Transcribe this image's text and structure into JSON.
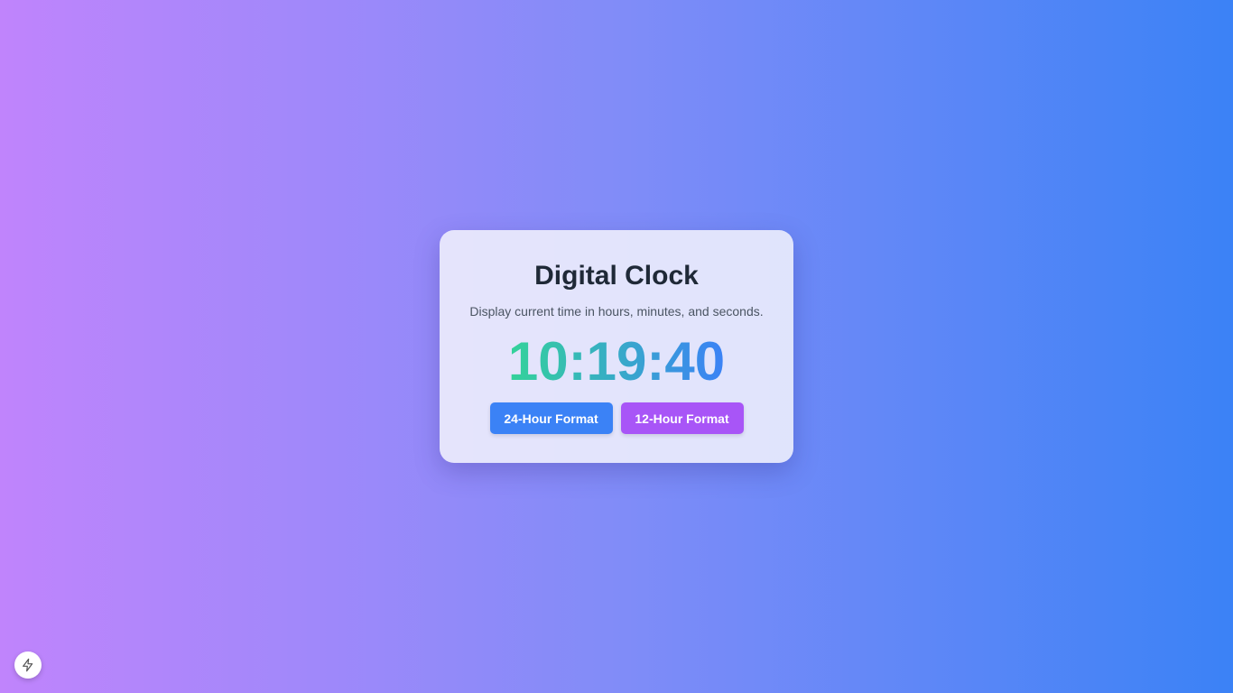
{
  "clock": {
    "title": "Digital Clock",
    "subtitle": "Display current time in hours, minutes, and seconds.",
    "time": "10:19:40",
    "buttons": {
      "format_24": "24-Hour Format",
      "format_12": "12-Hour Format"
    }
  },
  "corner_badge": {
    "icon": "lightning-bolt-icon"
  },
  "colors": {
    "button_24": "#3b82f6",
    "button_12": "#a855f7",
    "time_gradient_start": "#34d399",
    "time_gradient_end": "#3b82f6"
  }
}
